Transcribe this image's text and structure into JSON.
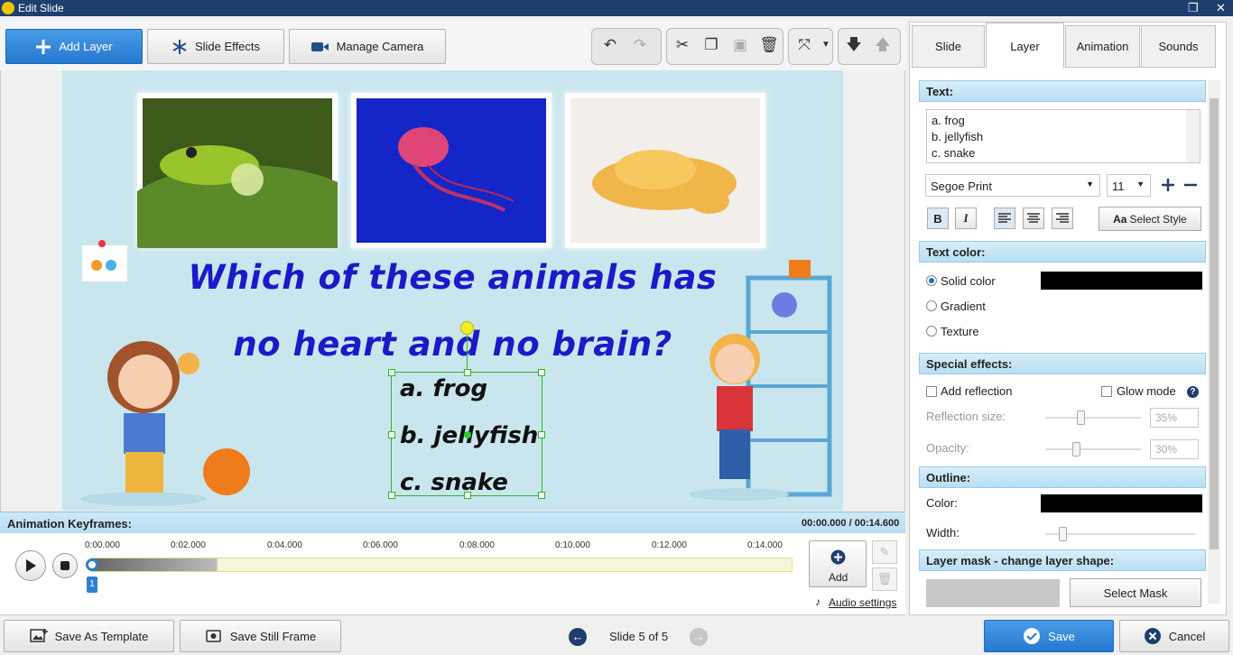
{
  "window": {
    "title": "Edit Slide",
    "icon": "app-icon",
    "restore_glyph": "❐",
    "close_glyph": "✕"
  },
  "toolbar": {
    "add_layer": "Add Layer",
    "slide_effects": "Slide Effects",
    "manage_camera": "Manage Camera",
    "icons": [
      "plus-icon",
      "snowflake-icon",
      "camera-icon",
      "undo-icon",
      "redo-icon",
      "cut-icon",
      "copy-icon",
      "paste-icon",
      "delete-icon",
      "fullscreen-icon",
      "move-down-icon",
      "move-up-icon"
    ]
  },
  "slide": {
    "question_line1": "Which of these animals has",
    "question_line2": "no heart and no brain?",
    "answers": [
      "a. frog",
      "b. jellyfish",
      "c. snake"
    ],
    "background_color": "#c9e6ee",
    "question_color": "#1a1ac8"
  },
  "keyframes": {
    "title": "Animation Keyframes:",
    "time_display": "00:00.000 / 00:14.600",
    "ticks": [
      "0:00.000",
      "0:02.000",
      "0:04.000",
      "0:06.000",
      "0:08.000",
      "0:10.000",
      "0:12.000",
      "0:14.000"
    ],
    "keyframe_number": "1",
    "add_label": "Add",
    "audio_settings": "Audio settings"
  },
  "bottom": {
    "save_template": "Save As Template",
    "save_still": "Save Still Frame",
    "slide_indicator": "Slide 5 of 5",
    "save": "Save",
    "cancel": "Cancel"
  },
  "panel": {
    "tabs": [
      "Slide",
      "Layer",
      "Animation",
      "Sounds"
    ],
    "active_tab": "Layer",
    "text_section": "Text:",
    "text_lines": [
      "a. frog",
      "b. jellyfish",
      "c. snake"
    ],
    "font_name": "Segoe Print",
    "font_size": "11",
    "bold": "B",
    "italic": "I",
    "select_style_icon": "Aa",
    "select_style": "Select Style",
    "text_color_section": "Text color:",
    "solid_color": "Solid color",
    "gradient": "Gradient",
    "texture": "Texture",
    "special_effects_section": "Special effects:",
    "add_reflection": "Add reflection",
    "glow_mode": "Glow mode",
    "help_glyph": "?",
    "reflection_size_label": "Reflection size:",
    "reflection_size_value": "35%",
    "opacity_label": "Opacity:",
    "opacity_value": "30%",
    "outline_section": "Outline:",
    "outline_color_label": "Color:",
    "outline_width_label": "Width:",
    "layer_mask_section": "Layer mask - change layer shape:",
    "select_mask": "Select Mask",
    "text_color_value": "#000000",
    "outline_color_value": "#000000"
  }
}
